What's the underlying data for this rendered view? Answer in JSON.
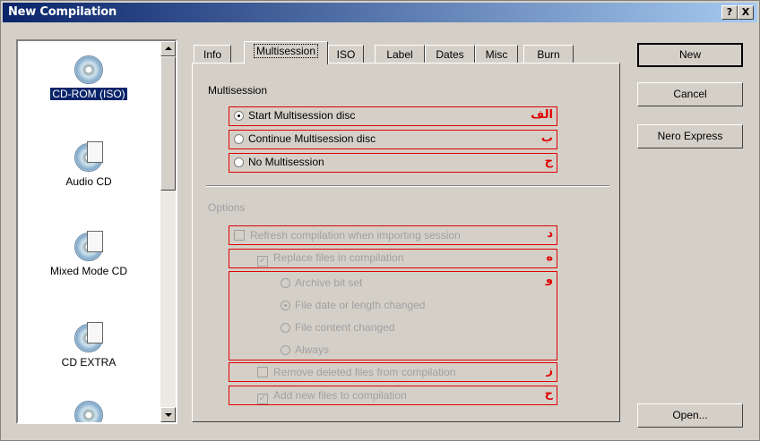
{
  "window": {
    "title": "New Compilation",
    "controls": {
      "help": "?",
      "close": "X"
    }
  },
  "compilation_types": [
    {
      "label": "CD-ROM (ISO)",
      "selected": true,
      "icon": "cd-rom-icon"
    },
    {
      "label": "Audio CD",
      "selected": false,
      "icon": "audio-cd-icon"
    },
    {
      "label": "Mixed Mode CD",
      "selected": false,
      "icon": "mixed-mode-cd-icon"
    },
    {
      "label": "CD EXTRA",
      "selected": false,
      "icon": "cd-extra-icon"
    }
  ],
  "tabs": [
    {
      "label": "Info",
      "active": false
    },
    {
      "label": "Multisession",
      "active": true
    },
    {
      "label": "ISO",
      "active": false
    },
    {
      "label": "Label",
      "active": false
    },
    {
      "label": "Dates",
      "active": false
    },
    {
      "label": "Misc",
      "active": false
    },
    {
      "label": "Burn",
      "active": false
    }
  ],
  "multisession": {
    "group_label": "Multisession",
    "options": [
      {
        "label": "Start Multisession disc",
        "checked": true,
        "marker": "الف"
      },
      {
        "label": "Continue Multisession disc",
        "checked": false,
        "marker": "ب"
      },
      {
        "label": "No Multisession",
        "checked": false,
        "marker": "ج"
      }
    ]
  },
  "options": {
    "group_label": "Options",
    "refresh": {
      "label": "Refresh compilation when importing session",
      "checked": false,
      "marker": "د"
    },
    "replace": {
      "label": "Replace files in compilation",
      "checked": true,
      "marker": "ه"
    },
    "replace_marker": "و",
    "replace_modes": [
      {
        "label": "Archive bit set",
        "checked": false
      },
      {
        "label": "File date or length changed",
        "checked": true
      },
      {
        "label": "File content changed",
        "checked": false
      },
      {
        "label": "Always",
        "checked": false
      }
    ],
    "remove_deleted": {
      "label": "Remove deleted files from compilation",
      "checked": false,
      "marker": "ز"
    },
    "add_new": {
      "label": "Add new files to compilation",
      "checked": true,
      "marker": "ح"
    }
  },
  "buttons": {
    "new": "New",
    "cancel": "Cancel",
    "nero_express": "Nero Express",
    "open": "Open..."
  },
  "colors": {
    "titlebar_start": "#0a246a",
    "titlebar_end": "#a6caf0",
    "annotation_red": "#e00000",
    "face": "#d4d0c8"
  }
}
